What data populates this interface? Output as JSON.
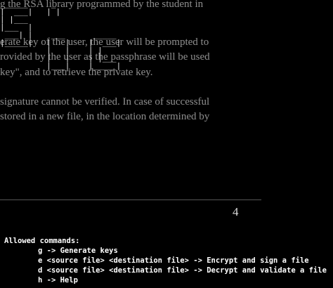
{
  "background_document": {
    "lines": [
      "g the RSA library programmed by the student in",
      "erate key of the user, the user will be prompted to",
      "rovided by the user as the passphrase will be used",
      "key\", and to retrieve the private key.",
      "signature cannot be verified. In case of successful",
      "stored in a new file, in the location determined by"
    ],
    "page_number": "4"
  },
  "ascii_art": {
    "lines": [
      " _____     _",
      "|  ___|   | |",
      "| |___",
      "|___  |",
      " ___| |    ___      _____",
      "|_____|   |   |    |  ___|",
      "          |   |    | |",
      "          |   |    | |___",
      "          |___|    |_____|"
    ]
  },
  "console": {
    "header": "Allowed commands:",
    "commands": [
      "g -> Generate keys",
      "e <source file> <destination file> -> Encrypt and sign a file",
      "d <source file> <destination file> -> Decrypt and validate a file",
      "h -> Help"
    ]
  }
}
